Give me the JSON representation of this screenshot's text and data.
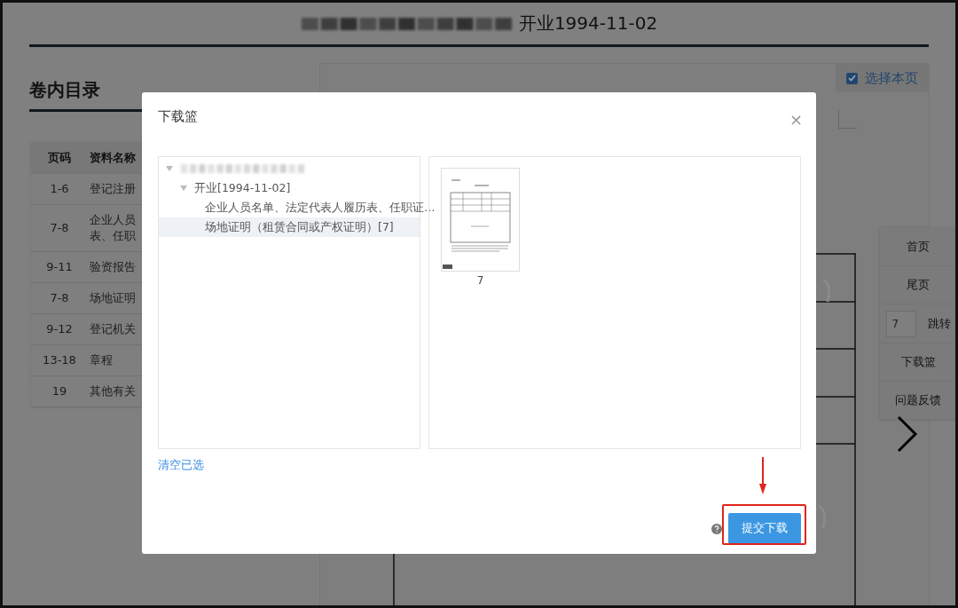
{
  "page": {
    "title": "开业1994-11-02",
    "toc_heading": "卷内目录",
    "toc_table": {
      "columns": [
        "页码",
        "资料名称"
      ],
      "rows": [
        {
          "pages": "1-6",
          "name": [
            "登记注册"
          ]
        },
        {
          "pages": "7-8",
          "name": [
            "企业人员",
            "表、任职"
          ]
        },
        {
          "pages": "9-11",
          "name": [
            "验资报告"
          ]
        },
        {
          "pages": "7-8",
          "name": [
            "场地证明"
          ]
        },
        {
          "pages": "9-12",
          "name": [
            "登记机关"
          ]
        },
        {
          "pages": "13-18",
          "name": [
            "章程"
          ]
        },
        {
          "pages": "19",
          "name": [
            "其他有关"
          ]
        }
      ]
    },
    "select_page": {
      "label": "选择本页",
      "checked": true
    },
    "side_menu": [
      {
        "kind": "button",
        "label": "首页"
      },
      {
        "kind": "button",
        "label": "尾页"
      },
      {
        "kind": "jump",
        "value": "7",
        "label": "跳转"
      },
      {
        "kind": "button",
        "label": "下载篮"
      },
      {
        "kind": "button",
        "label": "问题反馈"
      }
    ]
  },
  "dialog": {
    "title": "下载篮",
    "close": "×",
    "tree": [
      {
        "expanded": true,
        "children": [
          {
            "label": "开业[1994-11-02]",
            "expanded": true,
            "children": [
              {
                "label": "企业人员名单、法定代表人履历表、任职证…",
                "selected": false
              },
              {
                "label": "场地证明（租赁合同或产权证明）[7]",
                "selected": true
              }
            ]
          }
        ]
      }
    ],
    "thumbnails": [
      {
        "caption": "7"
      }
    ],
    "clear_link": "清空已选",
    "submit_button": "提交下载"
  }
}
